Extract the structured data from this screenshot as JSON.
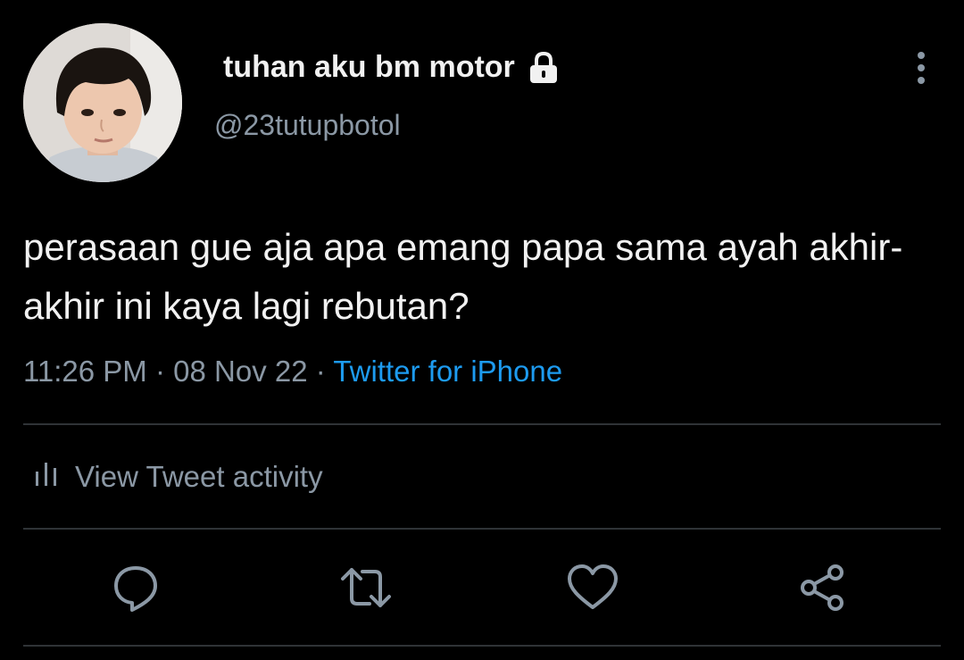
{
  "tweet": {
    "display_name": "tuhan aku bm motor",
    "handle": "@23tutupbotol",
    "text": "perasaan gue aja apa emang papa sama ayah akhir-akhir ini kaya lagi rebutan?",
    "time": "11:26 PM",
    "date": "08 Nov 22",
    "separator": " · ",
    "source": "Twitter for iPhone",
    "protected_icon": "lock-icon"
  },
  "activity": {
    "label": "View Tweet activity",
    "icon": "bar-chart-icon"
  },
  "actions": [
    {
      "name": "reply",
      "icon": "reply-icon"
    },
    {
      "name": "retweet",
      "icon": "retweet-icon"
    },
    {
      "name": "like",
      "icon": "heart-icon"
    },
    {
      "name": "share",
      "icon": "share-icon"
    }
  ],
  "colors": {
    "background": "#000000",
    "text_primary": "#f1f1f1",
    "text_secondary": "#8b98a5",
    "link": "#1d9bf0",
    "divider": "#2f3336"
  }
}
